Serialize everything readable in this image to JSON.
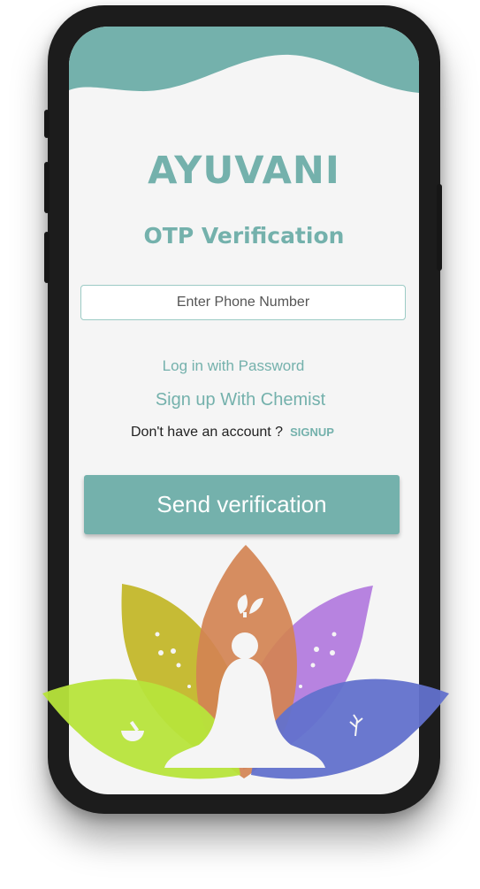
{
  "app": {
    "brand": "AYUVANI",
    "subtitle": "OTP Verification"
  },
  "form": {
    "phone_placeholder": "Enter Phone Number",
    "phone_value": ""
  },
  "links": {
    "login_password": "Log in with Password",
    "signup_chemist": "Sign up With Chemist",
    "no_account": "Don't have an account ?",
    "signup": "SIGNUP"
  },
  "actions": {
    "send_verification": "Send verification"
  },
  "colors": {
    "accent": "#74b1ac",
    "screen_bg": "#f5f5f5",
    "petal_green": "#b7e43b",
    "petal_olive": "#c1b520",
    "petal_orange": "#d38352",
    "petal_purple": "#b077de",
    "petal_blue": "#6271cc"
  },
  "icons": {
    "leaves": "leaves-icon",
    "mortar": "mortar-pestle-icon",
    "herb": "herb-branch-icon",
    "meditation": "meditating-figure-icon"
  }
}
